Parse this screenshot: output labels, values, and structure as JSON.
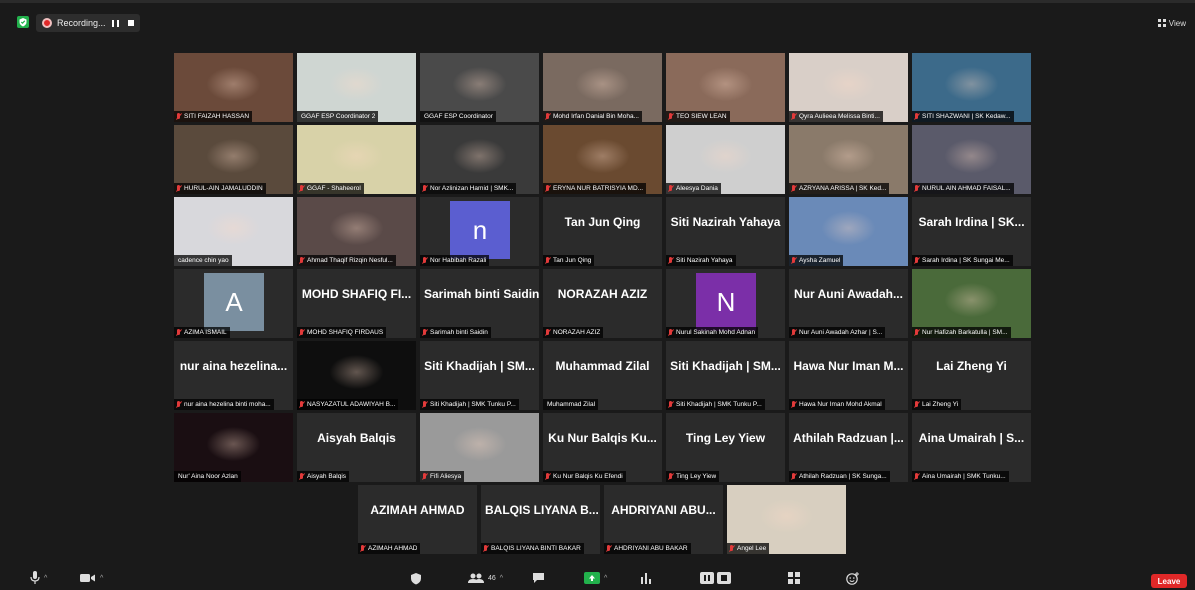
{
  "topbar": {
    "recording_label": "Recording...",
    "view_label": "View"
  },
  "colors": {
    "background": "#1a1a1a",
    "tile": "#2b2b2b",
    "active_speaker": "#e9e34a",
    "mute_red": "#e23a3a",
    "leave": "#e02828",
    "share_green": "#22b14c",
    "avatar_blue": "#5b5ed0",
    "avatar_grey": "#7a8fa0",
    "avatar_purple": "#7b2fa8"
  },
  "participants": [
    {
      "label": "SITI FAIZAH HASSAN",
      "muted": true,
      "video": "#6b4a3a"
    },
    {
      "label": "GGAF ESP Coordinator 2",
      "muted": false,
      "active": true,
      "video": "#cfd6d2"
    },
    {
      "label": "GGAF ESP Coordinator",
      "muted": false,
      "video": "#4a4a4a"
    },
    {
      "label": "Mohd Irfan Danial Bin Moha...",
      "muted": true,
      "video": "#7a6a60"
    },
    {
      "label": "TEO SIEW LEAN",
      "muted": true,
      "video": "#8a6a5a"
    },
    {
      "label": "Qyra Aulieea Melissa Binti...",
      "muted": true,
      "video": "#d9cfc8"
    },
    {
      "label": "SITI SHAZWANI | SK Kedaw...",
      "muted": true,
      "video": "#3c6a8a"
    },
    {
      "label": "HURUL-AIN JAMALUDDIN",
      "muted": true,
      "video": "#5a4a3c"
    },
    {
      "label": "GGAF - Shaheerol",
      "muted": true,
      "video": "#d8d2a8"
    },
    {
      "label": "Nor Azlinizan Hamid | SMK...",
      "muted": true,
      "video": "#3a3a3a"
    },
    {
      "label": "ERYNA NUR BATRISYIA MD...",
      "muted": true,
      "video": "#6a4a30"
    },
    {
      "label": "Aleesya Dania",
      "muted": true,
      "video": "#cfcfcf"
    },
    {
      "label": "AZRYANA ARISSA | SK Ked...",
      "muted": true,
      "video": "#8a7a6a"
    },
    {
      "label": "NURUL AIN AHMAD FAISAL...",
      "muted": true,
      "video": "#5a5a6a"
    },
    {
      "label": "cadence chin yao",
      "muted": false,
      "video": "#d8d8dc"
    },
    {
      "label": "Ahmad Thaqif Rizqin Nesful...",
      "muted": true,
      "video": "#5a4a48"
    },
    {
      "label": "Nor Habibah Razali",
      "muted": true,
      "avatar": "n",
      "avatar_color": "#5b5ed0"
    },
    {
      "label": "Tan Jun Qing",
      "muted": true,
      "big": "Tan Jun Qing"
    },
    {
      "label": "Siti Nazirah Yahaya",
      "muted": true,
      "big": "Siti Nazirah Yahaya"
    },
    {
      "label": "Aysha Zamuel",
      "muted": true,
      "video": "#6a8ab8"
    },
    {
      "label": "Sarah Irdina | SK Sungai Me...",
      "muted": true,
      "big": "Sarah Irdina | SK..."
    },
    {
      "label": "AZIMA ISMAIL",
      "muted": true,
      "avatar": "A",
      "avatar_color": "#7a8fa0"
    },
    {
      "label": "MOHD SHAFIQ FIRDAUS",
      "muted": true,
      "big": "MOHD SHAFIQ FI..."
    },
    {
      "label": "Sarimah binti Saidin",
      "muted": true,
      "big": "Sarimah binti Saidin"
    },
    {
      "label": "NORAZAH AZIZ",
      "muted": true,
      "big": "NORAZAH AZIZ"
    },
    {
      "label": "Nurul Sakinah Mohd Adnan",
      "muted": true,
      "avatar": "N",
      "avatar_color": "#7b2fa8"
    },
    {
      "label": "Nur Auni Awadah Azhar | S...",
      "muted": true,
      "big": "Nur Auni Awadah..."
    },
    {
      "label": "Nur Hafizah Barkatulla | SM...",
      "muted": true,
      "video": "#4a6a3a"
    },
    {
      "label": "nur aina hezelina binti moha...",
      "muted": true,
      "big": "nur aina hezelina..."
    },
    {
      "label": "NASYAZATUL ADAWIYAH B...",
      "muted": true,
      "video": "#0e0e0e"
    },
    {
      "label": "Siti Khadijah | SMK Tunku P...",
      "muted": true,
      "big": "Siti Khadijah | SM..."
    },
    {
      "label": "Muhammad Zilal",
      "muted": false,
      "big": "Muhammad Zilal"
    },
    {
      "label": "Siti Khadijah | SMK Tunku P...",
      "muted": true,
      "big": "Siti Khadijah | SM..."
    },
    {
      "label": "Hawa Nur Iman Mohd Akmal",
      "muted": true,
      "big": "Hawa Nur Iman M..."
    },
    {
      "label": "Lai Zheng Yi",
      "muted": true,
      "big": "Lai Zheng Yi"
    },
    {
      "label": "Nur' Aina Noor Azlan",
      "muted": false,
      "video": "#1a0e12"
    },
    {
      "label": "Aisyah Balqis",
      "muted": true,
      "big": "Aisyah Balqis"
    },
    {
      "label": "Fifi Aliesya",
      "muted": true,
      "video": "#9a9a9a"
    },
    {
      "label": "Ku Nur Balqis Ku Efendi",
      "muted": true,
      "big": "Ku Nur Balqis Ku..."
    },
    {
      "label": "Ting Ley Yiew",
      "muted": true,
      "big": "Ting Ley Yiew"
    },
    {
      "label": "Athilah Radzuan | SK Sunga...",
      "muted": true,
      "big": "Athilah Radzuan |..."
    },
    {
      "label": "Aina Umairah | SMK Tunku...",
      "muted": true,
      "big": "Aina Umairah | S..."
    },
    {
      "label": "AZIMAH AHMAD",
      "muted": true,
      "big": "AZIMAH AHMAD"
    },
    {
      "label": "BALQIS LIYANA BINTI BAKAR",
      "muted": true,
      "big": "BALQIS LIYANA B..."
    },
    {
      "label": "AHDRIYANI ABU BAKAR",
      "muted": true,
      "big": "AHDRIYANI ABU..."
    },
    {
      "label": "Angel Lee",
      "muted": true,
      "video": "#d8cfc0"
    }
  ],
  "toolbar": {
    "participant_count": "46",
    "leave_label": "Leave"
  }
}
